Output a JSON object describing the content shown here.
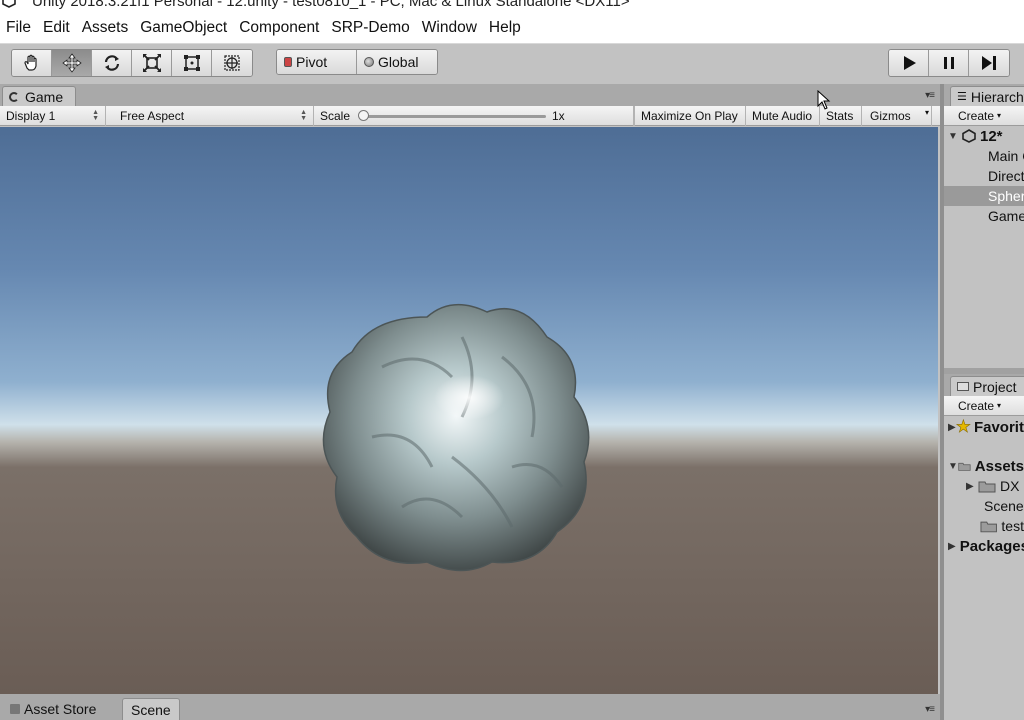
{
  "window": {
    "title": "Unity 2018.3.21f1 Personal - 12.unity - test0810_1 - PC, Mac & Linux Standalone <DX11>"
  },
  "menu": [
    "File",
    "Edit",
    "Assets",
    "GameObject",
    "Component",
    "SRP-Demo",
    "Window",
    "Help"
  ],
  "toolbar": {
    "tools": [
      "hand-tool",
      "move-tool",
      "rotate-tool",
      "scale-tool",
      "rect-tool",
      "transform-tool"
    ],
    "active_tool": "move-tool",
    "pivot_label": "Pivot",
    "global_label": "Global"
  },
  "game_view": {
    "tab_label": "Game",
    "display": "Display 1",
    "aspect": "Free Aspect",
    "scale_label": "Scale",
    "scale_value": "1x",
    "maximize_label": "Maximize On Play",
    "mute_label": "Mute Audio",
    "stats_label": "Stats",
    "gizmos_label": "Gizmos"
  },
  "bottom_tabs": {
    "asset_store": "Asset Store",
    "scene": "Scene"
  },
  "hierarchy": {
    "tab_label": "Hierarchy",
    "create_label": "Create",
    "scene_name": "12*",
    "items": [
      "Main Camera",
      "Directional Light",
      "Sphere",
      "GameObject"
    ],
    "selected_index": 2
  },
  "project": {
    "tab_label": "Project",
    "create_label": "Create",
    "favorites": "Favorites",
    "assets": "Assets",
    "asset_children": [
      "DX",
      "Scenes",
      "test"
    ],
    "packages": "Packages"
  },
  "colors": {
    "sky_top": "#4e6d95",
    "horizon": "#cfe0ea",
    "ground": "#6a5d55",
    "selection": "#9a9a9a"
  }
}
